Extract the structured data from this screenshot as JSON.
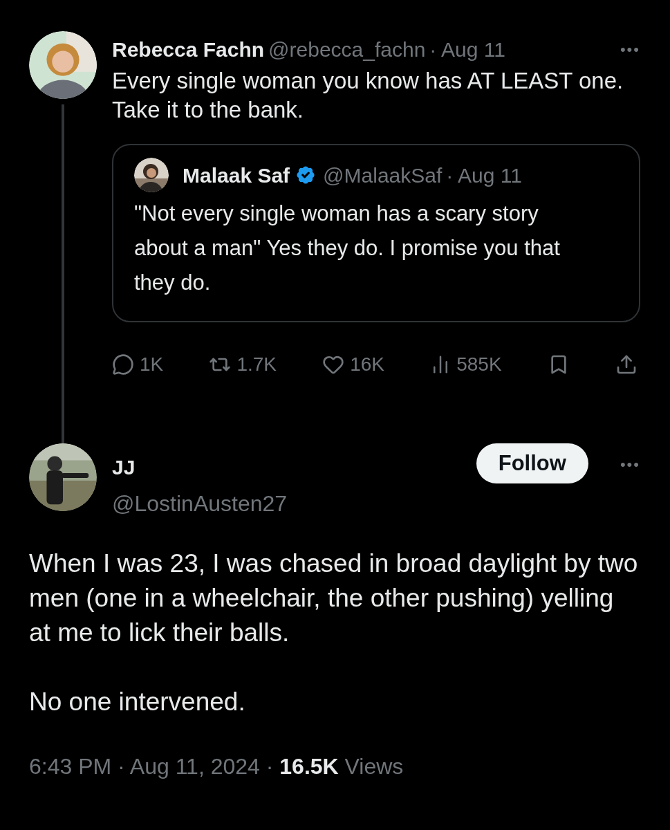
{
  "parent_post": {
    "author": {
      "name": "Rebecca Fachn",
      "handle": "@rebecca_fachn"
    },
    "date": "· Aug 11",
    "more": "•••",
    "text": "Every single woman you know has AT LEAST one. Take it to the bank.",
    "quote": {
      "author": {
        "name": "Malaak Saf",
        "handle": "@MalaakSaf",
        "verified": true
      },
      "date": "· Aug 11",
      "text": "\"Not every single woman has a scary story about a man\" Yes they do. I promise you that they do."
    },
    "stats": [
      {
        "kind": "reply",
        "count": "1K"
      },
      {
        "kind": "repost",
        "count": "1.7K"
      },
      {
        "kind": "like",
        "count": "16K"
      },
      {
        "kind": "views",
        "count": "585K"
      },
      {
        "kind": "bookmark"
      },
      {
        "kind": "share"
      }
    ]
  },
  "post": {
    "author": {
      "name": "JJ",
      "handle": "@LostinAusten27"
    },
    "follow_button": "Follow",
    "more": "•••",
    "paragraphs": [
      "When I was 23, I was chased in broad daylight by two men (one in a wheelchair, the other pushing) yelling at me to lick their balls.",
      "No one intervened."
    ],
    "meta": "6:43 PM · Aug 11, 2024 · **16.5K** Views"
  }
}
